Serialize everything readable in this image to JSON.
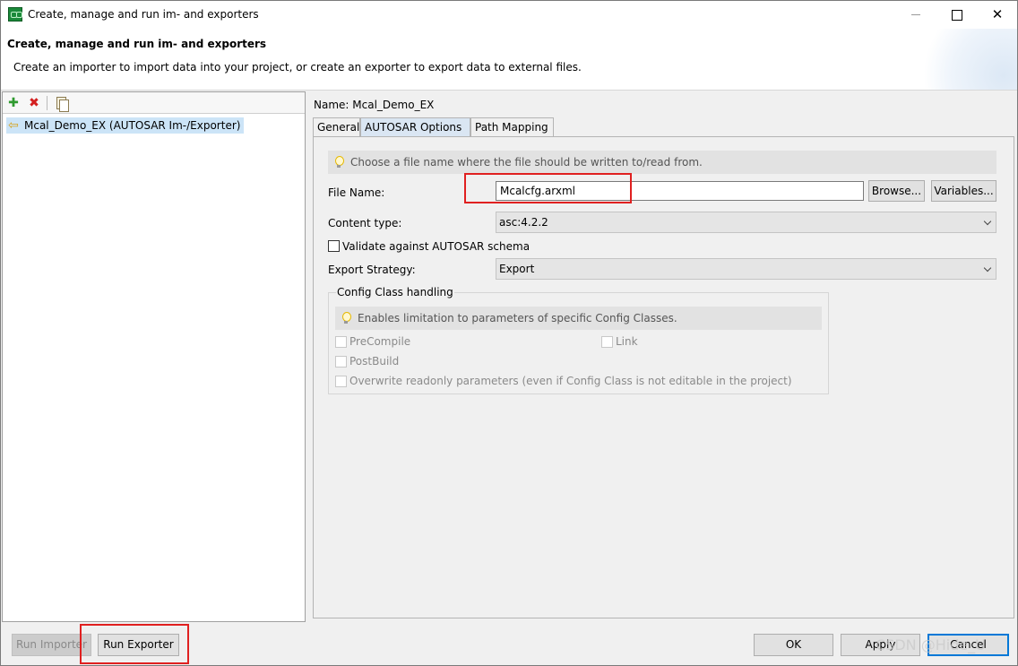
{
  "window": {
    "title": "Create, manage and run im- and exporters",
    "close_glyph": "✕"
  },
  "banner": {
    "title": "Create, manage and run im- and exporters",
    "description": "Create an importer to import data into your project, or create an exporter to export data to external files."
  },
  "left_panel": {
    "toolbar": {
      "add_glyph": "✚",
      "delete_glyph": "✖"
    },
    "tree_items": [
      {
        "label": "Mcal_Demo_EX (AUTOSAR Im-/Exporter)",
        "icon": "import-arrow-icon",
        "icon_glyph": "⇦"
      }
    ]
  },
  "detail": {
    "name_label": "Name:",
    "name_value": "Mcal_Demo_EX",
    "tabs": [
      {
        "label": "General",
        "active": false
      },
      {
        "label": "AUTOSAR Options",
        "active": true
      },
      {
        "label": "Path Mapping",
        "active": false
      }
    ],
    "hint": "Choose a file name where the file should be written to/read from.",
    "file_name_label": "File Name:",
    "file_name_value": "Mcalcfg.arxml",
    "browse_label": "Browse...",
    "variables_label": "Variables...",
    "content_type_label": "Content type:",
    "content_type_value": "asc:4.2.2",
    "validate_label": "Validate against AUTOSAR schema",
    "validate_checked": false,
    "export_strategy_label": "Export Strategy:",
    "export_strategy_value": "Export",
    "config_class": {
      "title": "Config Class handling",
      "hint": "Enables limitation to parameters of specific Config Classes.",
      "precompile_label": "PreCompile",
      "link_label": "Link",
      "postbuild_label": "PostBuild",
      "overwrite_label": "Overwrite readonly parameters (even if Config Class is not editable in the project)"
    }
  },
  "buttons": {
    "run_importer": "Run Importer",
    "run_exporter": "Run Exporter",
    "ok": "OK",
    "apply": "Apply",
    "cancel": "Cancel"
  },
  "watermark": "CSDN @Hide_U",
  "colors": {
    "highlight_red": "#e02020",
    "selection_blue": "#cce4f7",
    "tab_active": "#dae6f3",
    "primary_border": "#0078d7"
  }
}
